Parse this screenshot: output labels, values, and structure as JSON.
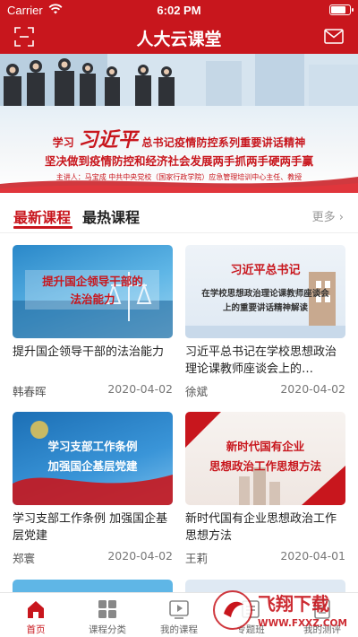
{
  "status_bar": {
    "carrier": "Carrier",
    "time": "6:02 PM",
    "battery_level": 0.85
  },
  "nav": {
    "title": "人大云课堂",
    "left_icon": "scan-icon",
    "right_icon": "mail-icon"
  },
  "banner": {
    "prefix": "学习",
    "name": "习近平",
    "line1_rest": "总书记疫情防控系列重要讲话精神",
    "line2": "坚决做到疫情防控和经济社会发展两手抓两手硬两手赢",
    "line3": "主讲人：马宝成 中共中央党校（国家行政学院）应急管理培训中心主任、教授"
  },
  "tabs": {
    "latest": "最新课程",
    "hottest": "最热课程",
    "more": "更多 ›"
  },
  "courses": [
    {
      "thumb_lines": [
        "提升国企领导干部的",
        "法治能力"
      ],
      "title": "提升国企领导干部的法治能力",
      "author": "韩春晖",
      "date": "2020-04-02"
    },
    {
      "thumb_lines": [
        "习近平总书记",
        "在学校思想政治理论课教师座谈会",
        "上的重要讲话精神解读"
      ],
      "title": "习近平总书记在学校思想政治理论课教师座谈会上的…",
      "author": "徐斌",
      "date": "2020-04-02"
    },
    {
      "thumb_lines": [
        "学习支部工作条例",
        "加强国企基层党建"
      ],
      "title": "学习支部工作条例 加强国企基层党建",
      "author": "郑寰",
      "date": "2020-04-02"
    },
    {
      "thumb_lines": [
        "新时代国有企业",
        "思想政治工作思想方法"
      ],
      "title": "新时代国有企业思想政治工作思想方法",
      "author": "王莉",
      "date": "2020-04-01"
    }
  ],
  "tabbar": [
    {
      "label": "首页",
      "icon": "home-icon",
      "active": true
    },
    {
      "label": "课程分类",
      "icon": "grid-icon",
      "active": false
    },
    {
      "label": "我的课程",
      "icon": "play-icon",
      "active": false
    },
    {
      "label": "专题班",
      "icon": "class-icon",
      "active": false
    },
    {
      "label": "我的测评",
      "icon": "test-icon",
      "active": false
    }
  ],
  "watermark": {
    "title": "飞翔下载",
    "url": "WWW.FXXZ.COM"
  },
  "colors": {
    "brand": "#c8161d",
    "text": "#222222",
    "muted": "#777777"
  }
}
